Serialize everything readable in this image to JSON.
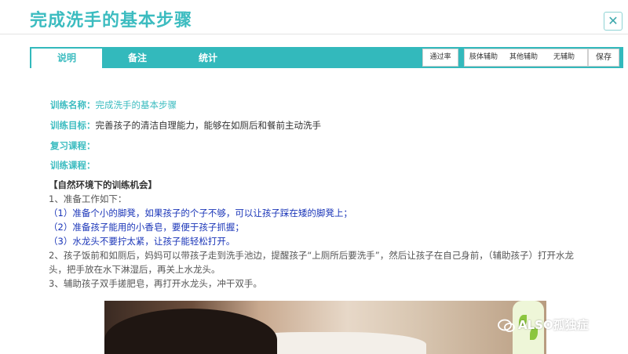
{
  "window": {
    "title": "完成洗手的基本步骤",
    "close_glyph": "✕"
  },
  "tabs": [
    {
      "label": "说明",
      "active": true
    },
    {
      "label": "备注",
      "active": false
    },
    {
      "label": "统计",
      "active": false
    }
  ],
  "toolbar": {
    "pass_rate_label": "通过率",
    "assist_options": [
      "肢体辅助",
      "其他辅助",
      "无辅助"
    ],
    "save_label": "保存"
  },
  "info": {
    "name_label": "训练名称：",
    "name_value": "完成洗手的基本步骤",
    "goal_label": "训练目标：",
    "goal_value": "完善孩子的清洁自理能力，能够在如厕后和餐前主动洗手",
    "review_label": "复习课程：",
    "course_label": "训练课程："
  },
  "body": {
    "section_title": "【自然环境下的训练机会】",
    "lines": [
      "1、准备工作如下：",
      "（1）准备个小的脚凳，如果孩子的个子不够，可以让孩子踩在矮的脚凳上；",
      "（2）准备孩子能用的小香皂，要便于孩子抓握；",
      "（3）水龙头不要拧太紧，让孩子能轻松打开。",
      "2、孩子饭前和如厕后，妈妈可以带孩子走到洗手池边，提醒孩子“上厕所后要洗手”，然后让孩子在自己身前，（辅助孩子）打开水龙",
      "头，把手放在水下淋湿后，再关上水龙头。",
      "3、辅助孩子双手搓肥皂，再打开水龙头，冲干双手。"
    ]
  },
  "watermark": {
    "text": "ALSO孤独症"
  },
  "colors": {
    "accent": "#3cbcc0",
    "tab_bar": "#33b9bc",
    "blue_text": "#1a35b8"
  }
}
